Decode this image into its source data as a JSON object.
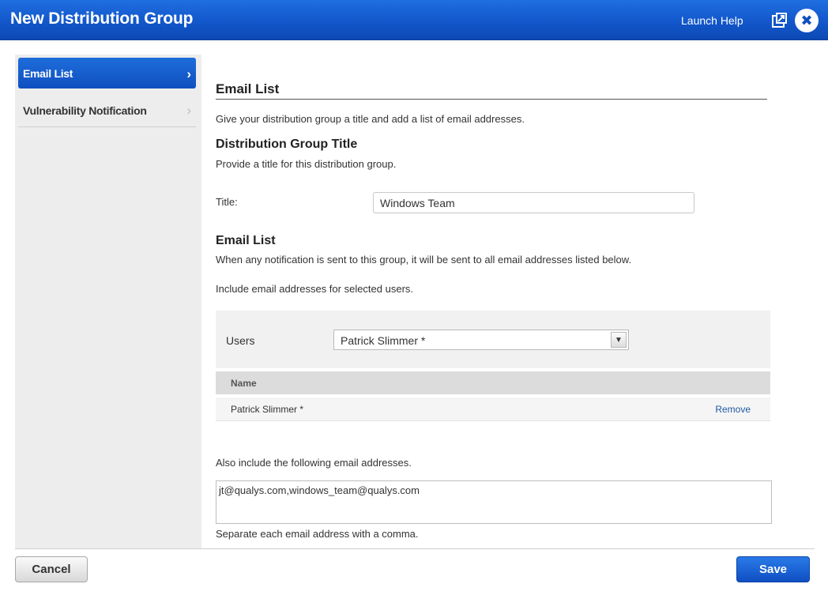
{
  "header": {
    "title": "New Distribution Group",
    "launch_help": "Launch Help",
    "popout_icon": "popout-icon",
    "close_icon": "close-icon",
    "accent_color": "#1257cb"
  },
  "sidebar": {
    "items": [
      {
        "label": "Email List",
        "active": true
      },
      {
        "label": "Vulnerability Notification",
        "active": false
      }
    ]
  },
  "main": {
    "section_title": "Email List",
    "section_desc": "Give your distribution group a title and add a list of email addresses.",
    "group_title": {
      "heading": "Distribution Group Title",
      "desc": "Provide a title for this distribution group.",
      "field_label": "Title:",
      "field_value": "Windows Team"
    },
    "email_list": {
      "heading": "Email List",
      "desc": "When any notification is sent to this group, it will be sent to all email addresses listed below.",
      "include_users_text": "Include email addresses for selected users.",
      "users_label": "Users",
      "users_selected": "Patrick Slimmer *",
      "table": {
        "column": "Name",
        "rows": [
          {
            "name": "Patrick Slimmer *",
            "action": "Remove"
          }
        ]
      },
      "also_include_text": "Also include the following email addresses.",
      "extra_emails": "jt@qualys.com,windows_team@qualys.com",
      "separator_hint": "Separate each email address with a comma."
    }
  },
  "footer": {
    "cancel_label": "Cancel",
    "save_label": "Save"
  }
}
